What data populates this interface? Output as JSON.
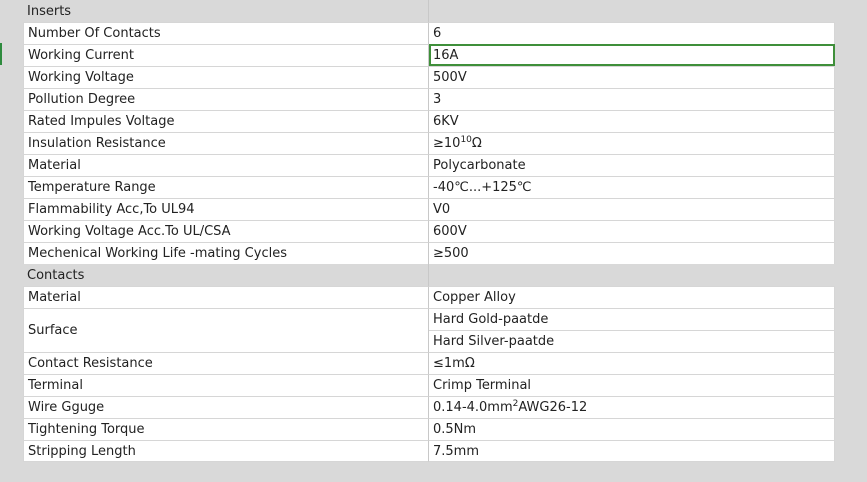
{
  "sheet": {
    "sections": [
      {
        "title": "Inserts",
        "rows": [
          {
            "label": "Number Of Contacts",
            "value": "6"
          },
          {
            "label": "Working Current",
            "value": "16A",
            "selected": true
          },
          {
            "label": "Working Voltage",
            "value": "500V"
          },
          {
            "label": "Pollution Degree",
            "value": "3"
          },
          {
            "label": "Rated Impules Voltage",
            "value": "6KV"
          },
          {
            "label": "Insulation Resistance",
            "value_prefix": "≥10",
            "value_sup": "10",
            "value_suffix": " Ω"
          },
          {
            "label": "Material",
            "value": "Polycarbonate"
          },
          {
            "label": "Temperature Range",
            "value": "-40℃...+125℃"
          },
          {
            "label": "Flammability Acc,To UL94",
            "value": "V0"
          },
          {
            "label": "Working Voltage Acc.To UL/CSA",
            "value": "600V"
          },
          {
            "label": "Mechenical Working Life -mating Cycles",
            "value": "≥500"
          }
        ]
      },
      {
        "title": "Contacts",
        "rows": [
          {
            "label": "Material",
            "value": "Copper Alloy"
          },
          {
            "label": "Surface",
            "values": [
              "Hard Gold-paatde",
              "Hard Silver-paatde"
            ]
          },
          {
            "label": "Contact Resistance",
            "value": "≤1mΩ"
          },
          {
            "label": "Terminal",
            "value": "Crimp Terminal"
          },
          {
            "label": "Wire Gguge",
            "value_prefix": "0.14-4.0mm",
            "value_sup": "2",
            "value_suffix": "AWG26-12"
          },
          {
            "label": "Tightening Torque",
            "value": "0.5Nm"
          },
          {
            "label": "Stripping Length",
            "value": "7.5mm"
          }
        ]
      }
    ]
  }
}
